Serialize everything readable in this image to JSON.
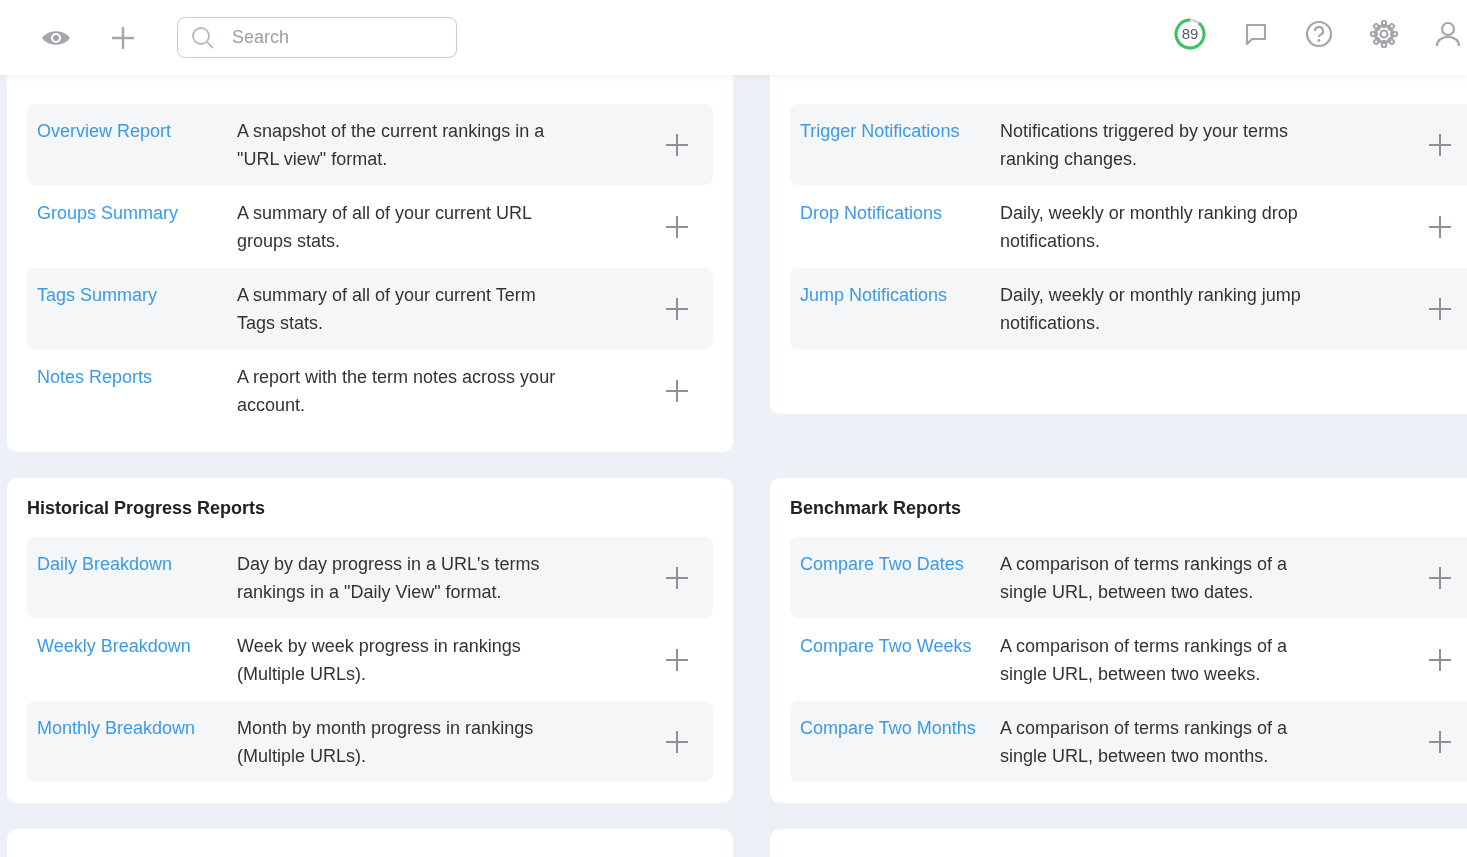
{
  "header": {
    "search": {
      "placeholder": "Search"
    },
    "score": {
      "value": "89",
      "level": 0.89
    }
  },
  "sections": [
    {
      "kind": "full",
      "reports": [
        {
          "name": "Overview Report",
          "description": "A snapshot of the current rankings in a \"URL view\" format."
        },
        {
          "name": "Groups Summary",
          "description": "A summary of all of your current URL groups stats."
        },
        {
          "name": "Tags Summary",
          "description": "A summary of all of your current Term Tags stats."
        },
        {
          "name": "Notes Reports",
          "description": "A report with the term notes across your account."
        }
      ]
    },
    {
      "kind": "full",
      "reports": [
        {
          "name": "Trigger Notifications",
          "description": "Notifications triggered by your terms ranking changes."
        },
        {
          "name": "Drop Notifications",
          "description": "Daily, weekly or monthly ranking drop notifications."
        },
        {
          "name": "Jump Notifications",
          "description": "Daily, weekly or monthly ranking jump notifications."
        }
      ]
    },
    {
      "kind": "full",
      "title": "Historical Progress Reports",
      "reports": [
        {
          "name": "Daily Breakdown",
          "description": "Day by day progress in a URL's terms rankings in a \"Daily View\" format."
        },
        {
          "name": "Weekly Breakdown",
          "description": "Week by week progress in rankings (Multiple URLs)."
        },
        {
          "name": "Monthly Breakdown",
          "description": "Month by month progress in rankings (Multiple URLs)."
        }
      ]
    },
    {
      "kind": "full",
      "title": "Benchmark Reports",
      "reports": [
        {
          "name": "Compare Two Dates",
          "description": "A comparison of terms rankings of a single URL, between two dates."
        },
        {
          "name": "Compare Two Weeks",
          "description": "A comparison of terms rankings of a single URL, between two weeks."
        },
        {
          "name": "Compare Two Months",
          "description": "A comparison of terms rankings of a single URL, between two months."
        }
      ]
    },
    {
      "kind": "collapsed"
    },
    {
      "kind": "collapsed"
    }
  ]
}
